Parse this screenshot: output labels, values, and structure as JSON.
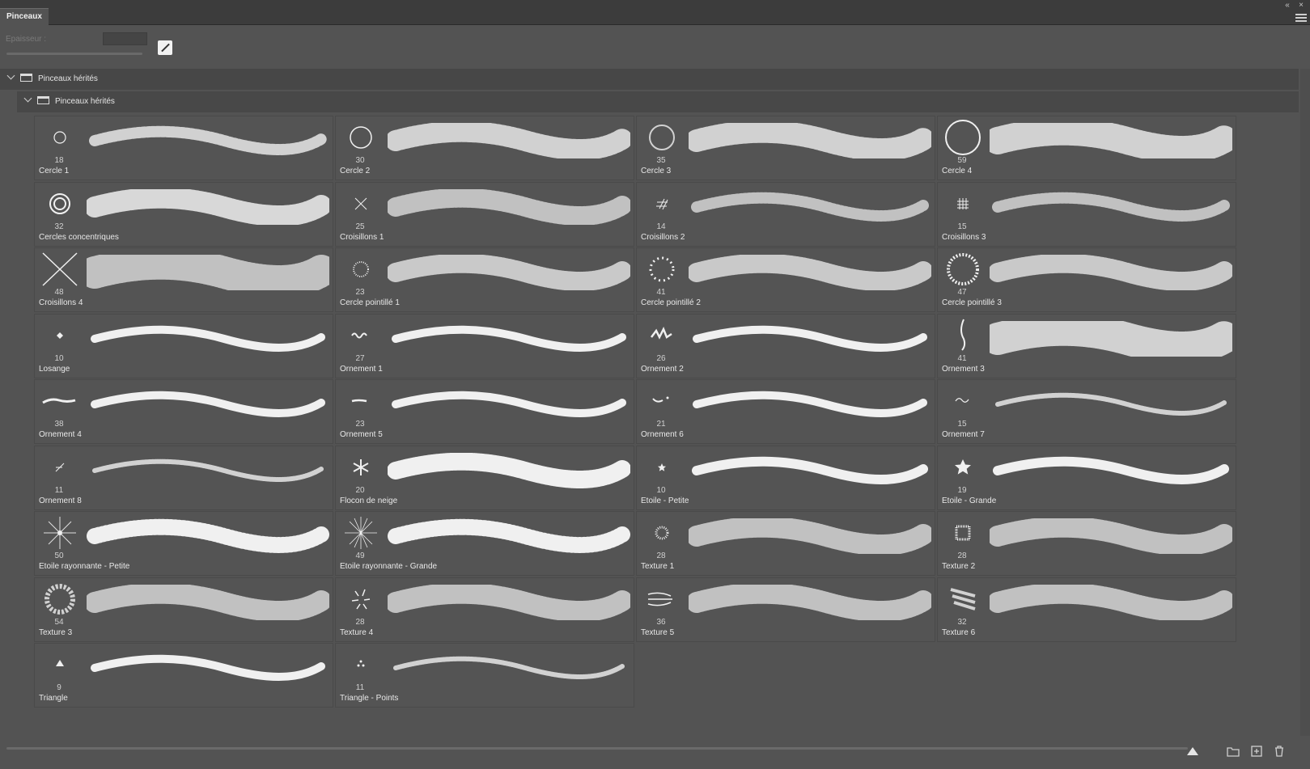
{
  "panel": {
    "tab_label": "Pinceaux",
    "collapse_icon": "double-chevron-left-icon",
    "close_icon": "close-icon",
    "menu_icon": "hamburger-menu-icon"
  },
  "toolbar": {
    "thickness_label": "Epaisseur :",
    "thickness_value": ""
  },
  "groups": [
    {
      "label": "Pinceaux hérités"
    },
    {
      "label": "Pinceaux hérités"
    }
  ],
  "brushes": [
    {
      "name": "Cercle 1",
      "size": "18",
      "tip": "circle-small"
    },
    {
      "name": "Cercle 2",
      "size": "30",
      "tip": "circle-medium"
    },
    {
      "name": "Cercle 3",
      "size": "35",
      "tip": "circle-large"
    },
    {
      "name": "Cercle 4",
      "size": "59",
      "tip": "circle-xlarge"
    },
    {
      "name": "Cercles concentriques",
      "size": "32",
      "tip": "concentric"
    },
    {
      "name": "Croisillons 1",
      "size": "25",
      "tip": "cross"
    },
    {
      "name": "Croisillons 2",
      "size": "14",
      "tip": "hash-tilt"
    },
    {
      "name": "Croisillons 3",
      "size": "15",
      "tip": "hash"
    },
    {
      "name": "Croisillons 4",
      "size": "48",
      "tip": "cross-large"
    },
    {
      "name": "Cercle pointillé 1",
      "size": "23",
      "tip": "dotted-circle"
    },
    {
      "name": "Cercle pointillé 2",
      "size": "41",
      "tip": "swirl"
    },
    {
      "name": "Cercle pointillé 3",
      "size": "47",
      "tip": "dotted-ring"
    },
    {
      "name": "Losange",
      "size": "10",
      "tip": "diamond"
    },
    {
      "name": "Ornement 1",
      "size": "27",
      "tip": "wave"
    },
    {
      "name": "Ornement 2",
      "size": "26",
      "tip": "zigzag"
    },
    {
      "name": "Ornement 3",
      "size": "41",
      "tip": "feather"
    },
    {
      "name": "Ornement 4",
      "size": "38",
      "tip": "brush-stroke"
    },
    {
      "name": "Ornement 5",
      "size": "23",
      "tip": "dash"
    },
    {
      "name": "Ornement 6",
      "size": "21",
      "tip": "dash-dot"
    },
    {
      "name": "Ornement 7",
      "size": "15",
      "tip": "squiggle"
    },
    {
      "name": "Ornement 8",
      "size": "11",
      "tip": "slash"
    },
    {
      "name": "Flocon de neige",
      "size": "20",
      "tip": "snowflake"
    },
    {
      "name": "Etoile - Petite",
      "size": "10",
      "tip": "star-small"
    },
    {
      "name": "Etoile - Grande",
      "size": "19",
      "tip": "star-large"
    },
    {
      "name": "Etoile rayonnante - Petite",
      "size": "50",
      "tip": "starburst"
    },
    {
      "name": "Etoile rayonnante - Grande",
      "size": "49",
      "tip": "starburst-large"
    },
    {
      "name": "Texture 1",
      "size": "28",
      "tip": "texture-dots"
    },
    {
      "name": "Texture 2",
      "size": "28",
      "tip": "texture-square"
    },
    {
      "name": "Texture 3",
      "size": "54",
      "tip": "texture-blob"
    },
    {
      "name": "Texture 4",
      "size": "28",
      "tip": "texture-splatter"
    },
    {
      "name": "Texture 5",
      "size": "36",
      "tip": "texture-streak"
    },
    {
      "name": "Texture 6",
      "size": "32",
      "tip": "texture-smear"
    },
    {
      "name": "Triangle",
      "size": "9",
      "tip": "triangle"
    },
    {
      "name": "Triangle - Points",
      "size": "11",
      "tip": "triangle-dots"
    }
  ],
  "bottom_bar": {
    "new_folder_icon": "folder-icon",
    "new_brush_icon": "plus-square-icon",
    "delete_icon": "trash-icon"
  },
  "colors": {
    "panel_bg": "#535353",
    "titlebar": "#3c3c3c",
    "text": "#e8e8e8",
    "brush_white": "#f0f0f0"
  }
}
